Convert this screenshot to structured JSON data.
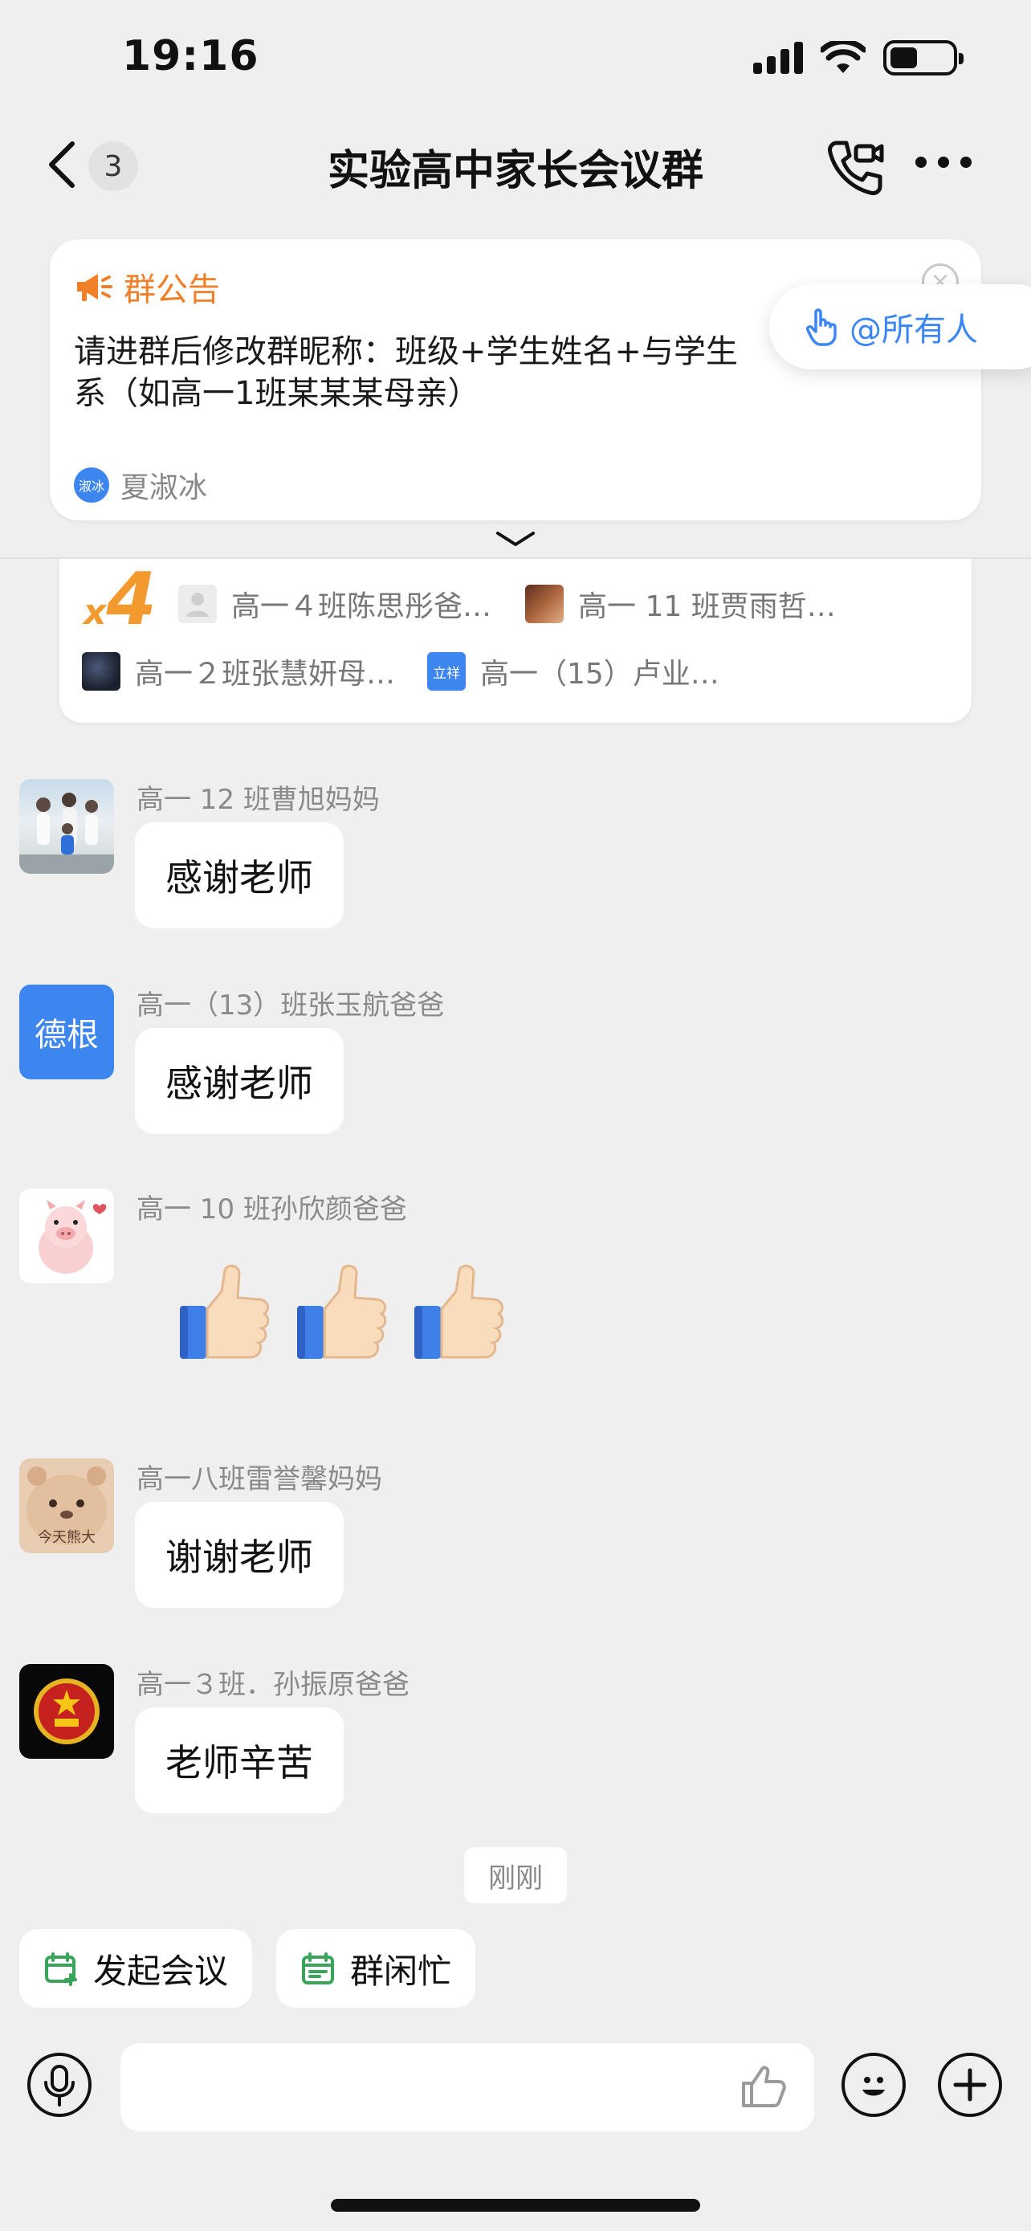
{
  "status_bar": {
    "time": "19:16"
  },
  "nav": {
    "badge": "3",
    "title": "实验高中家长会议群"
  },
  "announcement": {
    "header": "群公告",
    "line1": "请进群后修改群昵称：班级+学生姓名+与学生",
    "line2": "系（如高一1班某某某母亲）",
    "author_avatar": "淑冰",
    "author": "夏淑冰",
    "mention": "@所有人"
  },
  "reactions": {
    "prefix": "x",
    "count": "4",
    "items": [
      {
        "name": "高一４班陈思彤爸…"
      },
      {
        "name": "高一 11 班贾雨哲…"
      },
      {
        "name": "高一２班张慧妍母…"
      },
      {
        "name": "高一（15）卢业…",
        "avatar_text": "立祥"
      }
    ]
  },
  "messages": [
    {
      "sender": "高一 12 班曹旭妈妈",
      "text": "感谢老师"
    },
    {
      "sender": "高一（13）班张玉航爸爸",
      "text": "感谢老师",
      "avatar_text": "德根"
    },
    {
      "sender": "高一 10 班孙欣颜爸爸",
      "text": ""
    },
    {
      "sender": "高一八班雷誉馨妈妈",
      "text": "谢谢老师",
      "avatar_text": "今天熊大"
    },
    {
      "sender": "高一３班．孙振原爸爸",
      "text": "老师辛苦"
    }
  ],
  "time_divider": "刚刚",
  "quick_actions": {
    "meeting": "发起会议",
    "busy": "群闲忙"
  },
  "colors": {
    "accent": "#3a86f5",
    "orange": "#f07f27",
    "green": "#3aa55a"
  }
}
